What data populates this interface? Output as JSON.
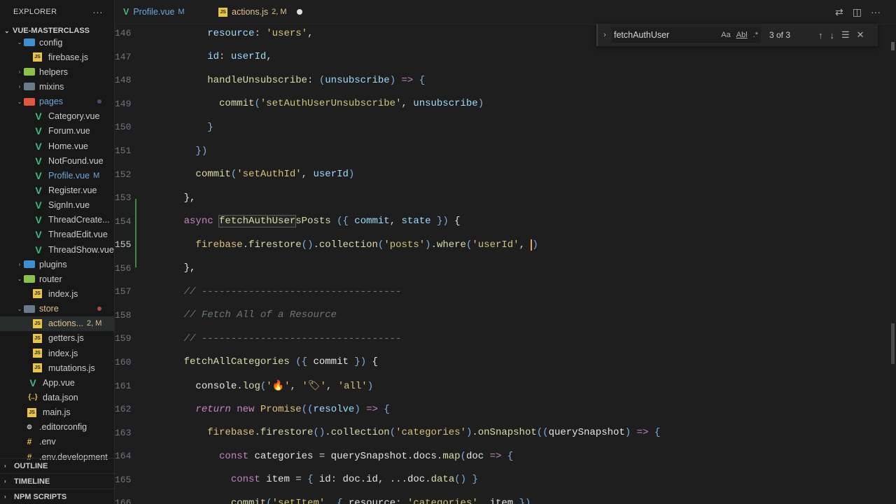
{
  "explorer": {
    "title": "EXPLORER",
    "more": "···",
    "root": "VUE-MASTERCLASS"
  },
  "tree": [
    {
      "name": "config",
      "kind": "folder-blue",
      "level": 1,
      "chev": "⌄"
    },
    {
      "name": "firebase.js",
      "kind": "js",
      "level": 2
    },
    {
      "name": "helpers",
      "kind": "folder-green",
      "level": 1,
      "chev": "›"
    },
    {
      "name": "mixins",
      "kind": "folder",
      "level": 1,
      "chev": "›"
    },
    {
      "name": "pages",
      "kind": "folder-red",
      "level": 1,
      "chev": "⌄",
      "dot": "#4a4a6a",
      "blue": true
    },
    {
      "name": "Category.vue",
      "kind": "vue",
      "level": 2
    },
    {
      "name": "Forum.vue",
      "kind": "vue",
      "level": 2
    },
    {
      "name": "Home.vue",
      "kind": "vue",
      "level": 2
    },
    {
      "name": "NotFound.vue",
      "kind": "vue",
      "level": 2
    },
    {
      "name": "Profile.vue",
      "kind": "vue",
      "level": 2,
      "badge": "M",
      "blue": true
    },
    {
      "name": "Register.vue",
      "kind": "vue",
      "level": 2
    },
    {
      "name": "SignIn.vue",
      "kind": "vue",
      "level": 2
    },
    {
      "name": "ThreadCreate...",
      "kind": "vue",
      "level": 2
    },
    {
      "name": "ThreadEdit.vue",
      "kind": "vue",
      "level": 2
    },
    {
      "name": "ThreadShow.vue",
      "kind": "vue",
      "level": 2
    },
    {
      "name": "plugins",
      "kind": "folder-blue",
      "level": 1,
      "chev": "›"
    },
    {
      "name": "router",
      "kind": "folder-green",
      "level": 1,
      "chev": "⌄"
    },
    {
      "name": "index.js",
      "kind": "js",
      "level": 2
    },
    {
      "name": "store",
      "kind": "folder",
      "level": 1,
      "chev": "⌄",
      "dot": "#b04a4a",
      "modified": true
    },
    {
      "name": "actions...",
      "kind": "js",
      "level": 2,
      "badge": "2, M",
      "modified": true,
      "selected": true
    },
    {
      "name": "getters.js",
      "kind": "js",
      "level": 2
    },
    {
      "name": "index.js",
      "kind": "js",
      "level": 2
    },
    {
      "name": "mutations.js",
      "kind": "js",
      "level": 2
    },
    {
      "name": "App.vue",
      "kind": "vue",
      "level": 1
    },
    {
      "name": "data.json",
      "kind": "json",
      "level": 1
    },
    {
      "name": "main.js",
      "kind": "js",
      "level": 1
    },
    {
      "name": ".editorconfig",
      "kind": "gear",
      "level": 0
    },
    {
      "name": ".env",
      "kind": "hash",
      "level": 0
    },
    {
      "name": ".env.development",
      "kind": "hash",
      "level": 0
    }
  ],
  "sections": [
    "OUTLINE",
    "TIMELINE",
    "NPM SCRIPTS"
  ],
  "tabs": [
    {
      "label": "Profile.vue",
      "state": "M",
      "icon": "V",
      "active": false
    },
    {
      "label": "actions.js",
      "state": "2, M",
      "icon": "JS",
      "active": true
    }
  ],
  "find": {
    "query": "fetchAuthUser",
    "count": "3 of 3",
    "opt_case": "Aa",
    "opt_word": "Abl",
    "opt_regex": ".*"
  },
  "lines": [
    {
      "n": "146",
      "html": "        <span class='var'>resource</span><span class='pun'>: </span><span class='str'>'users'</span><span class='pun'>,</span>"
    },
    {
      "n": "147",
      "html": "        <span class='var'>id</span><span class='pun'>: </span><span class='var'>userId</span><span class='pun'>,</span>"
    },
    {
      "n": "148",
      "html": "        <span class='fn'>handleUnsubscribe</span><span class='pun'>: </span><span class='brk'>(</span><span class='var'>unsubscribe</span><span class='brk'>)</span><span class='pun'> </span><span class='kw'>=&gt;</span><span class='pun'> </span><span class='brk'>{</span>"
    },
    {
      "n": "149",
      "html": "          <span class='fn'>commit</span><span class='brk'>(</span><span class='str'>'setAuthUserUnsubscribe'</span><span class='pun'>, </span><span class='var'>unsubscribe</span><span class='brk'>)</span>"
    },
    {
      "n": "150",
      "html": "        <span class='brk'>}</span>"
    },
    {
      "n": "151",
      "html": "      <span class='brk'>})</span>"
    },
    {
      "n": "152",
      "html": "      <span class='fn'>commit</span><span class='brk'>(</span><span class='str'>'setAuthId'</span><span class='pun'>, </span><span class='var'>userId</span><span class='brk'>)</span>"
    },
    {
      "n": "153",
      "html": "    <span class='white'>},</span>"
    },
    {
      "n": "154",
      "html": "    <span class='kw'>async</span> <span class='fn highlight-box'>fetchAuthUser</span><span class='fn'>sPosts</span> <span class='brk'>(</span><span class='brk'>{</span> <span class='var'>commit</span><span class='pun'>,</span> <span class='var'>state</span> <span class='brk'>}</span><span class='brk'>)</span> <span class='white'>{</span>"
    },
    {
      "n": "155",
      "cur": true,
      "html": "      <span class='obj'>firebase</span><span class='pun'>.</span><span class='fn'>firestore</span><span class='brk'>()</span><span class='pun'>.</span><span class='fn'>collection</span><span class='brk'>(</span><span class='str'>'posts'</span><span class='brk'>)</span><span class='pun'>.</span><span class='fn'>where</span><span class='brk'>(</span><span class='str'>'userId'</span><span class='pun'>, </span><span class='brk cursor'>)</span>"
    },
    {
      "n": "156",
      "html": "    <span class='white'>},</span>"
    },
    {
      "n": "157",
      "html": "    <span class='cm'>// ----------------------------------</span>"
    },
    {
      "n": "158",
      "html": "    <span class='cm'>// Fetch All of a Resource</span>"
    },
    {
      "n": "159",
      "html": "    <span class='cm'>// ----------------------------------</span>"
    },
    {
      "n": "160",
      "html": "    <span class='fn'>fetchAllCategories</span> <span class='brk'>(</span><span class='brk'>{</span> <span class='white'>commit</span> <span class='brk'>}</span><span class='brk'>)</span> <span class='white'>{</span>"
    },
    {
      "n": "161",
      "html": "      <span class='white'>console</span><span class='pun'>.</span><span class='fn'>log</span><span class='brk'>(</span><span class='str'>'🔥'</span><span class='pun'>, </span><span class='str'>'🏷'</span><span class='pun'>, </span><span class='str'>'all'</span><span class='brk'>)</span>"
    },
    {
      "n": "162",
      "html": "      <span class='kwi'>return</span> <span class='kw'>new</span> <span class='obj'>Promise</span><span class='brk'>(</span><span class='brk'>(</span><span class='var'>resolve</span><span class='brk'>)</span> <span class='kw'>=&gt;</span> <span class='brk'>{</span>"
    },
    {
      "n": "163",
      "html": "        <span class='obj'>firebase</span><span class='pun'>.</span><span class='fn'>firestore</span><span class='brk'>()</span><span class='pun'>.</span><span class='fn'>collection</span><span class='brk'>(</span><span class='str'>'categories'</span><span class='brk'>)</span><span class='pun'>.</span><span class='fn'>onSnapshot</span><span class='brk'>(</span><span class='brk'>(</span><span class='white'>querySnapshot</span><span class='brk'>)</span> <span class='kw'>=&gt;</span> <span class='brk'>{</span>"
    },
    {
      "n": "164",
      "html": "          <span class='kw'>const</span> <span class='white'>categories</span> <span class='pun'>=</span> <span class='white'>querySnapshot</span><span class='pun'>.</span><span class='white'>docs</span><span class='pun'>.</span><span class='fn'>map</span><span class='brk'>(</span><span class='white'>doc</span> <span class='kw'>=&gt;</span> <span class='brk'>{</span>"
    },
    {
      "n": "165",
      "html": "            <span class='kw'>const</span> <span class='white'>item</span> <span class='pun'>=</span> <span class='brk'>{</span> <span class='white'>id</span><span class='pun'>:</span> <span class='white'>doc</span><span class='pun'>.</span><span class='white'>id</span><span class='pun'>,</span> <span class='pun'>...</span><span class='white'>doc</span><span class='pun'>.</span><span class='fn'>data</span><span class='brk'>()</span> <span class='brk'>}</span>"
    },
    {
      "n": "166",
      "html": "            <span class='fn'>commit</span><span class='brk'>(</span><span class='str'>'setItem'</span><span class='pun'>, </span><span class='brk'>{</span> <span class='white'>resource</span><span class='pun'>:</span> <span class='str'>'categories'</span><span class='pun'>, </span><span class='white'>item</span> <span class='brk'>}</span><span class='brk'>)</span>"
    }
  ]
}
